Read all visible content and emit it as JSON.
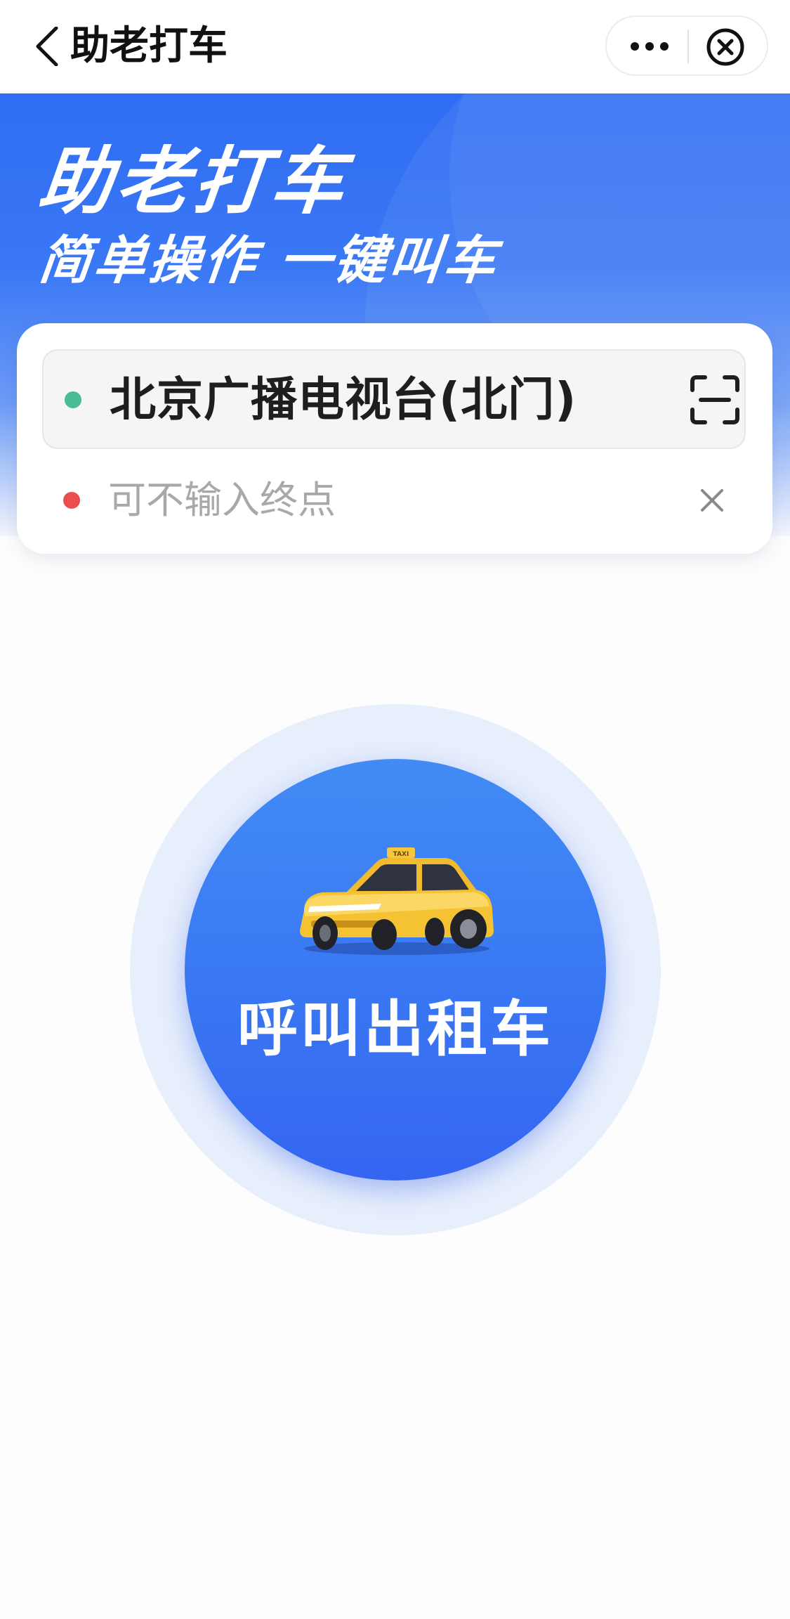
{
  "navbar": {
    "title": "助老打车",
    "back_icon": "chevron-left-icon",
    "more_icon": "more-dots-icon",
    "close_icon": "close-circle-icon"
  },
  "hero": {
    "title": "助老打车",
    "subtitle": "简单操作 一键叫车"
  },
  "address": {
    "start_value": "北京广播电视台(北门)",
    "start_dot_color": "#4bbd95",
    "end_placeholder": "可不输入终点",
    "end_value": "",
    "end_dot_color": "#ea4e4e",
    "scan_icon": "scan-icon",
    "clear_icon": "close-icon"
  },
  "call": {
    "label": "呼叫出租车",
    "taxi_sign": "TAXI",
    "icon": "taxi-car-icon"
  },
  "colors": {
    "accent": "#3a79f3",
    "hero_start": "#2f6df4",
    "halo": "#e7eefc"
  }
}
